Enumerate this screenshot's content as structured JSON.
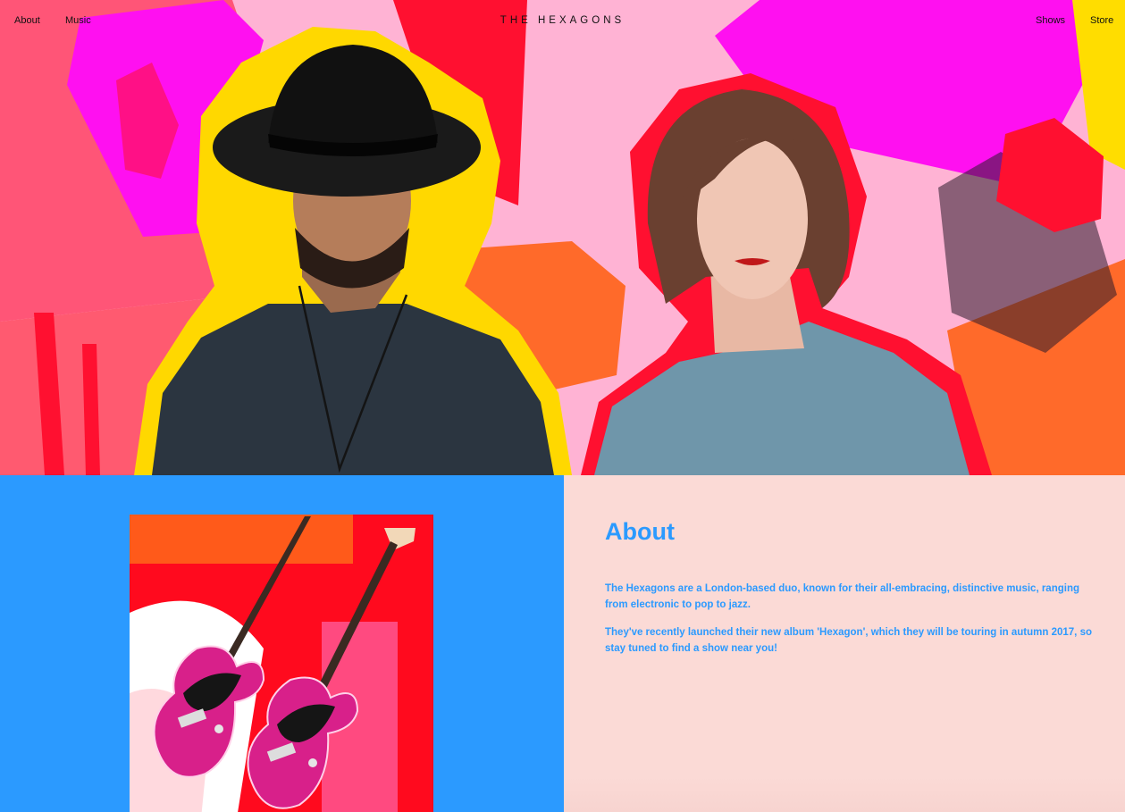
{
  "nav": {
    "left": [
      {
        "label": "About"
      },
      {
        "label": "Music"
      }
    ],
    "brand": "THE HEXAGONS",
    "right": [
      {
        "label": "Shows"
      },
      {
        "label": "Store"
      }
    ]
  },
  "about": {
    "title": "About",
    "paragraphs": [
      "The Hexagons are a London-based duo, known for their all-embracing, distinctive music, ranging from electronic to pop to jazz.",
      "They've recently launched their new album 'Hexagon', which they will be touring in autumn 2017, so stay tuned to find a show near you!"
    ]
  },
  "colors": {
    "hero_background": "#ffb3d4",
    "left_panel": "#2b9aff",
    "right_panel": "#fbdad6",
    "accent_text": "#2b9aff",
    "magenta": "#ff10f0",
    "red": "#ff1030",
    "yellow": "#ffdd00",
    "orange": "#ff6a2a"
  }
}
